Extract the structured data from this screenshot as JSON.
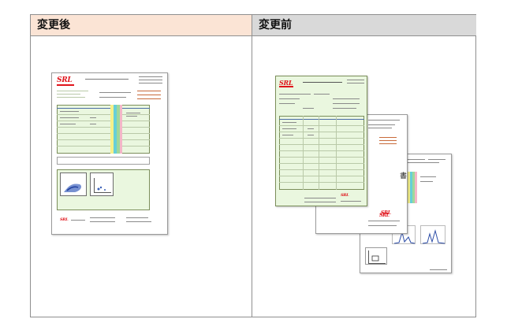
{
  "columns": {
    "after_label": "変更後",
    "before_label": "変更前"
  },
  "colors": {
    "after_header_bg": "#fbe4d5",
    "before_header_bg": "#d9d9d9",
    "report_green": "#eaf7df",
    "logo_red": "#e0141b",
    "stripe_yellow": "#f5f08a",
    "stripe_cyan": "#66cfd8",
    "stripe_green": "#9fd89a",
    "stripe_pink": "#f4b6c8"
  },
  "after_report": {
    "logo_text": "SRL"
  },
  "before_reports": {
    "front_logo_text": "SRL",
    "mid_logo_text": "SRL",
    "back_logo_text": "SRL"
  }
}
